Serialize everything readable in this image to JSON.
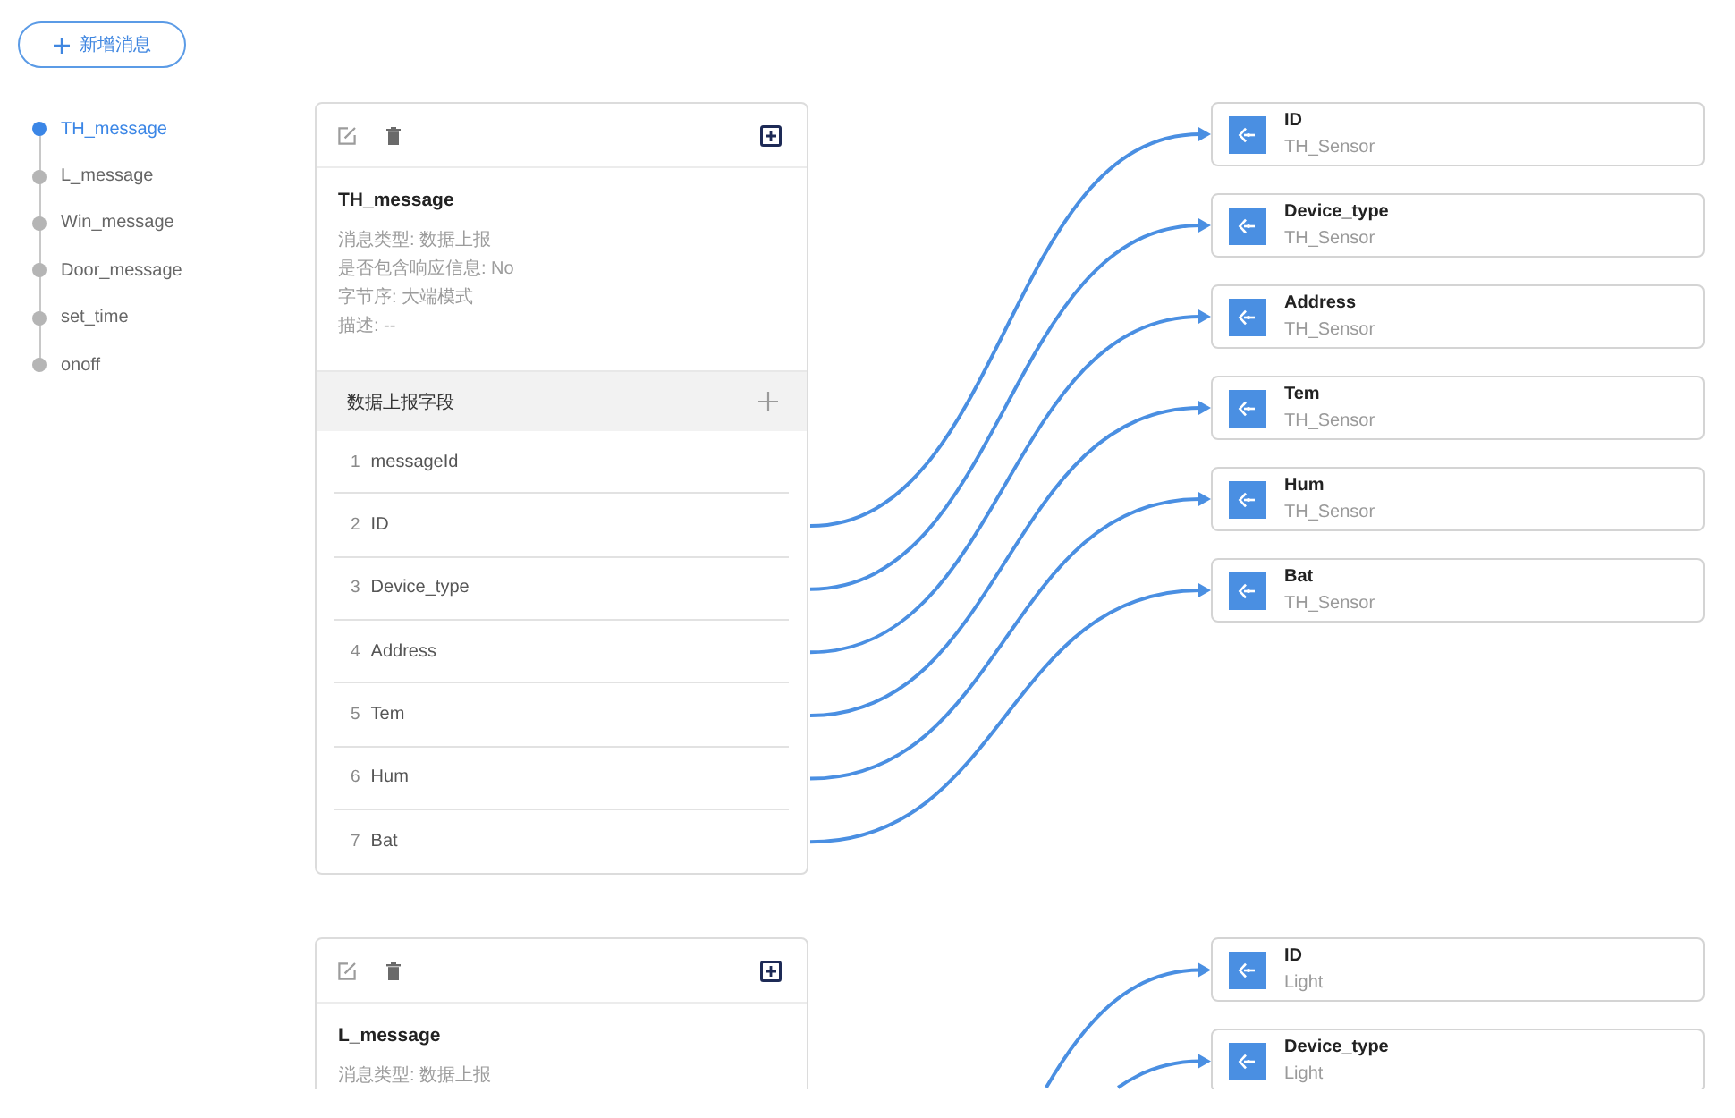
{
  "add_button": {
    "label": "新增消息"
  },
  "message_list": [
    {
      "label": "TH_message",
      "selected": true
    },
    {
      "label": "L_message",
      "selected": false
    },
    {
      "label": "Win_message",
      "selected": false
    },
    {
      "label": "Door_message",
      "selected": false
    },
    {
      "label": "set_time",
      "selected": false
    },
    {
      "label": "onoff",
      "selected": false
    }
  ],
  "groups": [
    {
      "card": {
        "title": "TH_message",
        "info": [
          "消息类型: 数据上报",
          "是否包含响应信息: No",
          "字节序: 大端模式",
          "描述: --"
        ],
        "section": {
          "label": "数据上报字段"
        },
        "fields": [
          {
            "index": "1",
            "name": "messageId"
          },
          {
            "index": "2",
            "name": "ID"
          },
          {
            "index": "3",
            "name": "Device_type"
          },
          {
            "index": "4",
            "name": "Address"
          },
          {
            "index": "5",
            "name": "Tem"
          },
          {
            "index": "6",
            "name": "Hum"
          },
          {
            "index": "7",
            "name": "Bat"
          }
        ]
      },
      "nodes": [
        {
          "title": "ID",
          "subtitle": "TH_Sensor",
          "linked": true
        },
        {
          "title": "Device_type",
          "subtitle": "TH_Sensor",
          "linked": true
        },
        {
          "title": "Address",
          "subtitle": "TH_Sensor",
          "linked": true
        },
        {
          "title": "Tem",
          "subtitle": "TH_Sensor",
          "linked": true
        },
        {
          "title": "Hum",
          "subtitle": "TH_Sensor",
          "linked": true
        },
        {
          "title": "Bat",
          "subtitle": "TH_Sensor",
          "linked": true
        }
      ]
    },
    {
      "card": {
        "title": "L_message",
        "info": [
          "消息类型: 数据上报"
        ]
      },
      "nodes": [
        {
          "title": "ID",
          "subtitle": "Light",
          "linked": true
        },
        {
          "title": "Device_type",
          "subtitle": "Light",
          "linked": true
        }
      ]
    }
  ]
}
